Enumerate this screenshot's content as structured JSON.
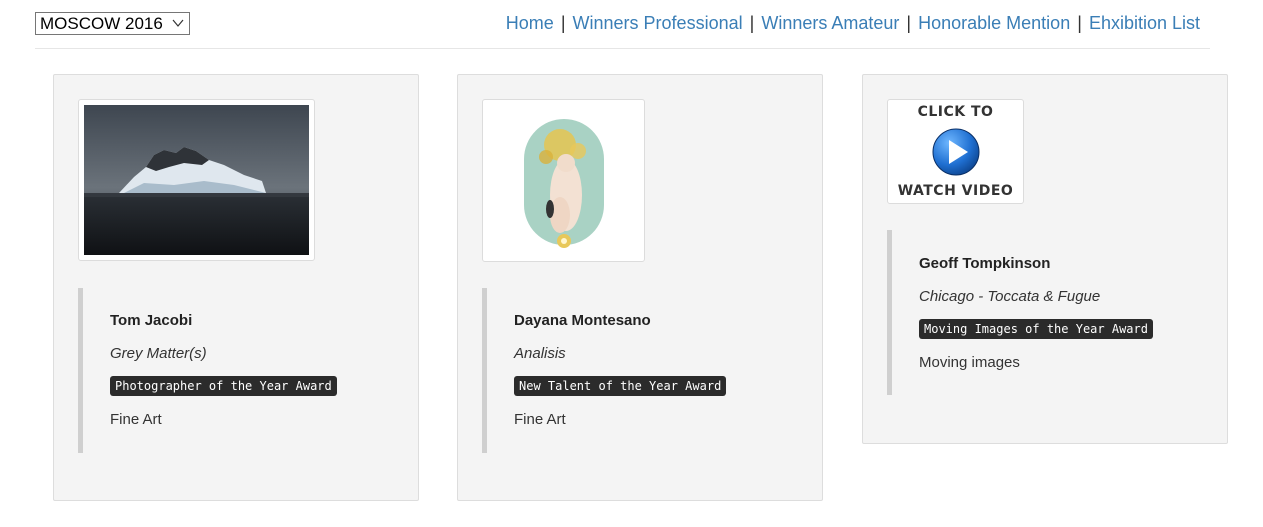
{
  "event_select": {
    "value": "MOSCOW 2016",
    "icon": "chevron-down-icon"
  },
  "nav": {
    "items": [
      {
        "label": "Home"
      },
      {
        "label": "Winners Professional"
      },
      {
        "label": "Winners Amateur"
      },
      {
        "label": "Honorable Mention"
      },
      {
        "label": "Ehxibition List"
      }
    ],
    "separator": "|",
    "link_color": "#3a7eb6"
  },
  "cards": [
    {
      "name": "Tom Jacobi",
      "title": "Grey Matter(s)",
      "award": "Photographer of the Year Award",
      "category": "Fine Art",
      "image": "iceberg-photo"
    },
    {
      "name": "Dayana Montesano",
      "title": "Analisis",
      "award": "New Talent of the Year Award",
      "category": "Fine Art",
      "image": "figure-in-capsule-photo"
    },
    {
      "name": "Geoff Tompkinson",
      "title": "Chicago - Toccata & Fugue",
      "award": "Moving Images of the Year Award",
      "category": "Moving images",
      "video_top": "CLICK TO",
      "video_bottom": "WATCH VIDEO",
      "image": "play-video-icon"
    }
  ]
}
